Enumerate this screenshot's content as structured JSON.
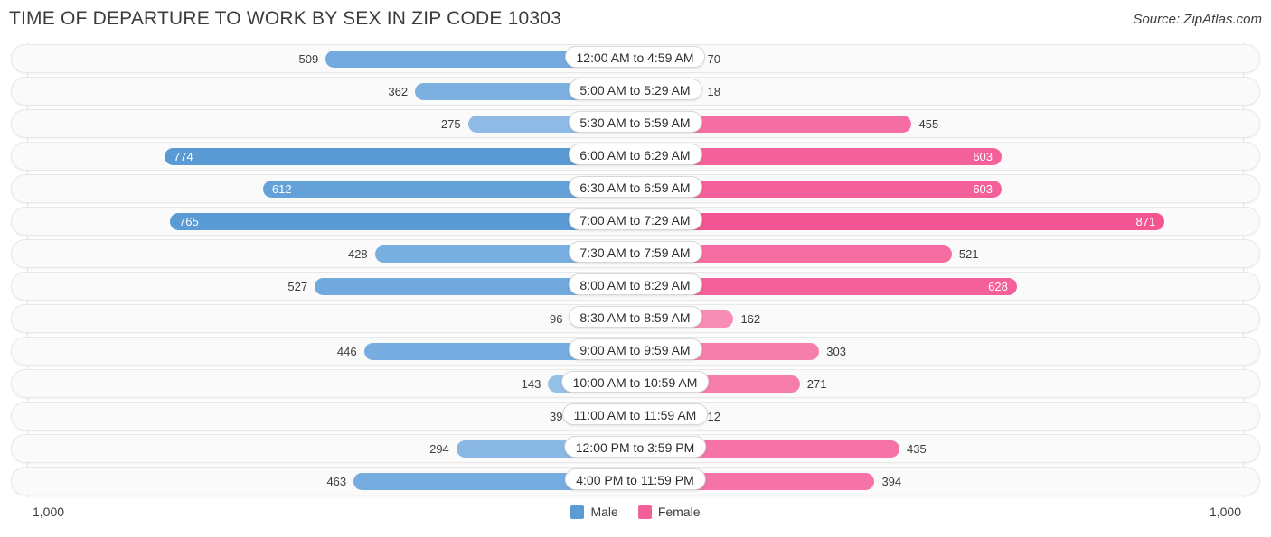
{
  "header": {
    "title": "TIME OF DEPARTURE TO WORK BY SEX IN ZIP CODE 10303",
    "source": "Source: ZipAtlas.com"
  },
  "footer": {
    "axis_left": "1,000",
    "axis_right": "1,000",
    "legend": [
      {
        "label": "Male",
        "color": "#5b9bd5"
      },
      {
        "label": "Female",
        "color": "#f4609a"
      }
    ]
  },
  "chart_data": {
    "type": "bar",
    "orientation": "horizontal-diverging",
    "title": "TIME OF DEPARTURE TO WORK BY SEX IN ZIP CODE 10303",
    "xlabel": "",
    "ylabel": "",
    "xlim": [
      -1000,
      1000
    ],
    "axis_max": 1000,
    "grid": true,
    "legend_position": "bottom-center",
    "categories": [
      "12:00 AM to 4:59 AM",
      "5:00 AM to 5:29 AM",
      "5:30 AM to 5:59 AM",
      "6:00 AM to 6:29 AM",
      "6:30 AM to 6:59 AM",
      "7:00 AM to 7:29 AM",
      "7:30 AM to 7:59 AM",
      "8:00 AM to 8:29 AM",
      "8:30 AM to 8:59 AM",
      "9:00 AM to 9:59 AM",
      "10:00 AM to 10:59 AM",
      "11:00 AM to 11:59 AM",
      "12:00 PM to 3:59 PM",
      "4:00 PM to 11:59 PM"
    ],
    "series": [
      {
        "name": "Male",
        "color": "#5b9bd5",
        "values": [
          509,
          362,
          275,
          774,
          612,
          765,
          428,
          527,
          96,
          446,
          143,
          39,
          294,
          463
        ]
      },
      {
        "name": "Female",
        "color": "#f4609a",
        "values": [
          70,
          18,
          455,
          603,
          603,
          871,
          521,
          628,
          162,
          303,
          271,
          12,
          435,
          394
        ]
      }
    ]
  },
  "rows": [
    {
      "category": "12:00 AM to 4:59 AM",
      "male": 509,
      "female": 70,
      "male_label": "509",
      "female_label": "70",
      "male_inside": false,
      "female_inside": false,
      "male_color": "#73a9de",
      "female_color": "#f7a3c2"
    },
    {
      "category": "5:00 AM to 5:29 AM",
      "male": 362,
      "female": 18,
      "male_label": "362",
      "female_label": "18",
      "male_inside": false,
      "female_inside": false,
      "male_color": "#7cb0e1",
      "female_color": "#f8a9c6"
    },
    {
      "category": "5:30 AM to 5:59 AM",
      "male": 275,
      "female": 455,
      "male_label": "275",
      "female_label": "455",
      "male_inside": false,
      "female_inside": false,
      "male_color": "#8ebae5",
      "female_color": "#f56fa4"
    },
    {
      "category": "6:00 AM to 6:29 AM",
      "male": 774,
      "female": 603,
      "male_label": "774",
      "female_label": "603",
      "male_inside": true,
      "female_inside": true,
      "male_color": "#5b9bd5",
      "female_color": "#f4609a"
    },
    {
      "category": "6:30 AM to 6:59 AM",
      "male": 612,
      "female": 603,
      "male_label": "612",
      "female_label": "603",
      "male_inside": true,
      "female_inside": true,
      "male_color": "#64a1d8",
      "female_color": "#f4609a"
    },
    {
      "category": "7:00 AM to 7:29 AM",
      "male": 765,
      "female": 871,
      "male_label": "765",
      "female_label": "871",
      "male_inside": true,
      "female_inside": true,
      "male_color": "#5b9bd5",
      "female_color": "#f25592"
    },
    {
      "category": "7:30 AM to 7:59 AM",
      "male": 428,
      "female": 521,
      "male_label": "428",
      "female_label": "521",
      "male_inside": false,
      "female_inside": false,
      "male_color": "#79aee0",
      "female_color": "#f66da2"
    },
    {
      "category": "8:00 AM to 8:29 AM",
      "male": 527,
      "female": 628,
      "male_label": "527",
      "female_label": "628",
      "male_inside": false,
      "female_inside": true,
      "male_color": "#71a8dd",
      "female_color": "#f4609a"
    },
    {
      "category": "8:30 AM to 8:59 AM",
      "male": 96,
      "female": 162,
      "male_label": "96",
      "female_label": "162",
      "male_inside": false,
      "female_inside": false,
      "male_color": "#9bc3e9",
      "female_color": "#f78cb4"
    },
    {
      "category": "9:00 AM to 9:59 AM",
      "male": 446,
      "female": 303,
      "male_label": "446",
      "female_label": "303",
      "male_inside": false,
      "female_inside": false,
      "male_color": "#77ace0",
      "female_color": "#f67fac"
    },
    {
      "category": "10:00 AM to 10:59 AM",
      "male": 143,
      "female": 271,
      "male_label": "143",
      "female_label": "271",
      "male_inside": false,
      "female_inside": false,
      "male_color": "#97c0e8",
      "female_color": "#f77dab"
    },
    {
      "category": "11:00 AM to 11:59 AM",
      "male": 39,
      "female": 12,
      "male_label": "39",
      "female_label": "12",
      "male_inside": false,
      "female_inside": false,
      "male_color": "#9ec5ea",
      "female_color": "#f8a9c6"
    },
    {
      "category": "12:00 PM to 3:59 PM",
      "male": 294,
      "female": 435,
      "male_label": "294",
      "female_label": "435",
      "male_inside": false,
      "female_inside": false,
      "male_color": "#8ab8e4",
      "female_color": "#f573a6"
    },
    {
      "category": "4:00 PM to 11:59 PM",
      "male": 463,
      "female": 394,
      "male_label": "463",
      "female_label": "394",
      "male_inside": false,
      "female_inside": false,
      "male_color": "#76abdf",
      "female_color": "#f573a6"
    }
  ]
}
